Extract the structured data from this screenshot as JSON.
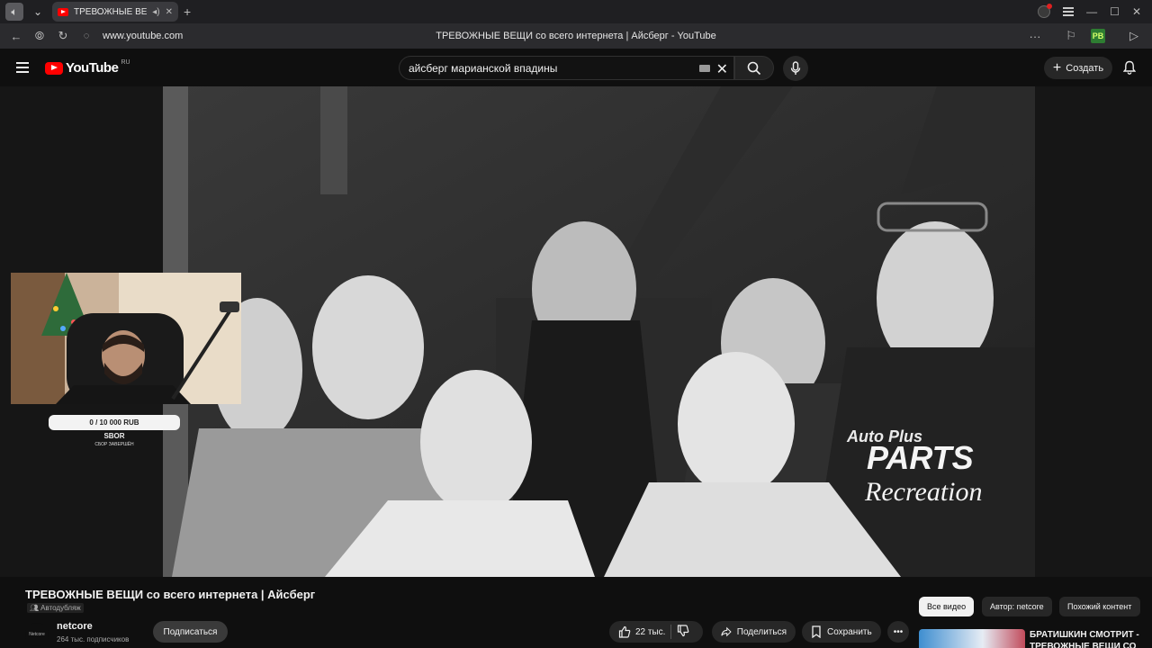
{
  "browser": {
    "tab_title": "ТРЕВОЖНЫЕ ВЕЩИ",
    "url": "www.youtube.com",
    "page_title": "ТРЕВОЖНЫЕ ВЕЩИ со всего интернета | Айсберг - YouTube",
    "extension_badge": "PB"
  },
  "header": {
    "logo_text": "YouTube",
    "logo_region": "RU",
    "search_value": "айсберг марианской впадины",
    "create_label": "Создать"
  },
  "overlay": {
    "donation_progress": "0 / 10 000 RUB",
    "donation_title": "SBOR",
    "donation_status": "СБОР ЗАВЕРШЁН"
  },
  "video": {
    "title": "ТРЕВОЖНЫЕ ВЕЩИ со всего интернета | Айсберг",
    "dub_label": "Автодубляж",
    "channel_avatar_text": "Netcore",
    "channel_name": "netcore",
    "subscribers": "264 тыс. подписчиков",
    "subscribe_label": "Подписаться",
    "likes": "22 тыс.",
    "share_label": "Поделиться",
    "save_label": "Сохранить",
    "shirt_text_1": "Auto Plus",
    "shirt_text_2": "PARTS",
    "shirt_text_3": "Recreation"
  },
  "chips": [
    {
      "label": "Все видео",
      "active": true
    },
    {
      "label": "Автор: netcore",
      "active": false
    },
    {
      "label": "Похожий контент",
      "active": false
    }
  ],
  "recommendation": {
    "title": "БРАТИШКИН СМОТРИТ - ТРЕВОЖНЫЕ ВЕЩИ СО ВСЕГО"
  },
  "colors": {
    "background": "#0f0f0f",
    "brand_red": "#ff0000",
    "chip_active": "#f1f1f1"
  }
}
